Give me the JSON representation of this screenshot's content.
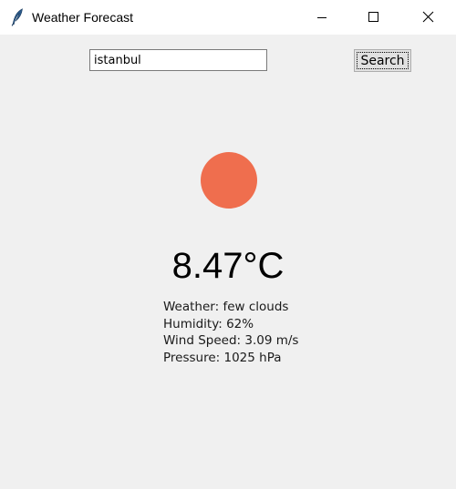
{
  "window": {
    "title": "Weather Forecast",
    "icon": "feather-icon"
  },
  "controls": {
    "minimize_icon": "minimize-icon",
    "maximize_icon": "maximize-icon",
    "close_icon": "close-icon"
  },
  "search": {
    "value": "istanbul",
    "button_label": "Search"
  },
  "weather": {
    "icon_color": "#ef6e4e",
    "temperature": "8.47°C",
    "details": [
      "Weather: few clouds",
      "Humidity: 62%",
      "Wind Speed: 3.09 m/s",
      "Pressure: 1025 hPa"
    ]
  }
}
